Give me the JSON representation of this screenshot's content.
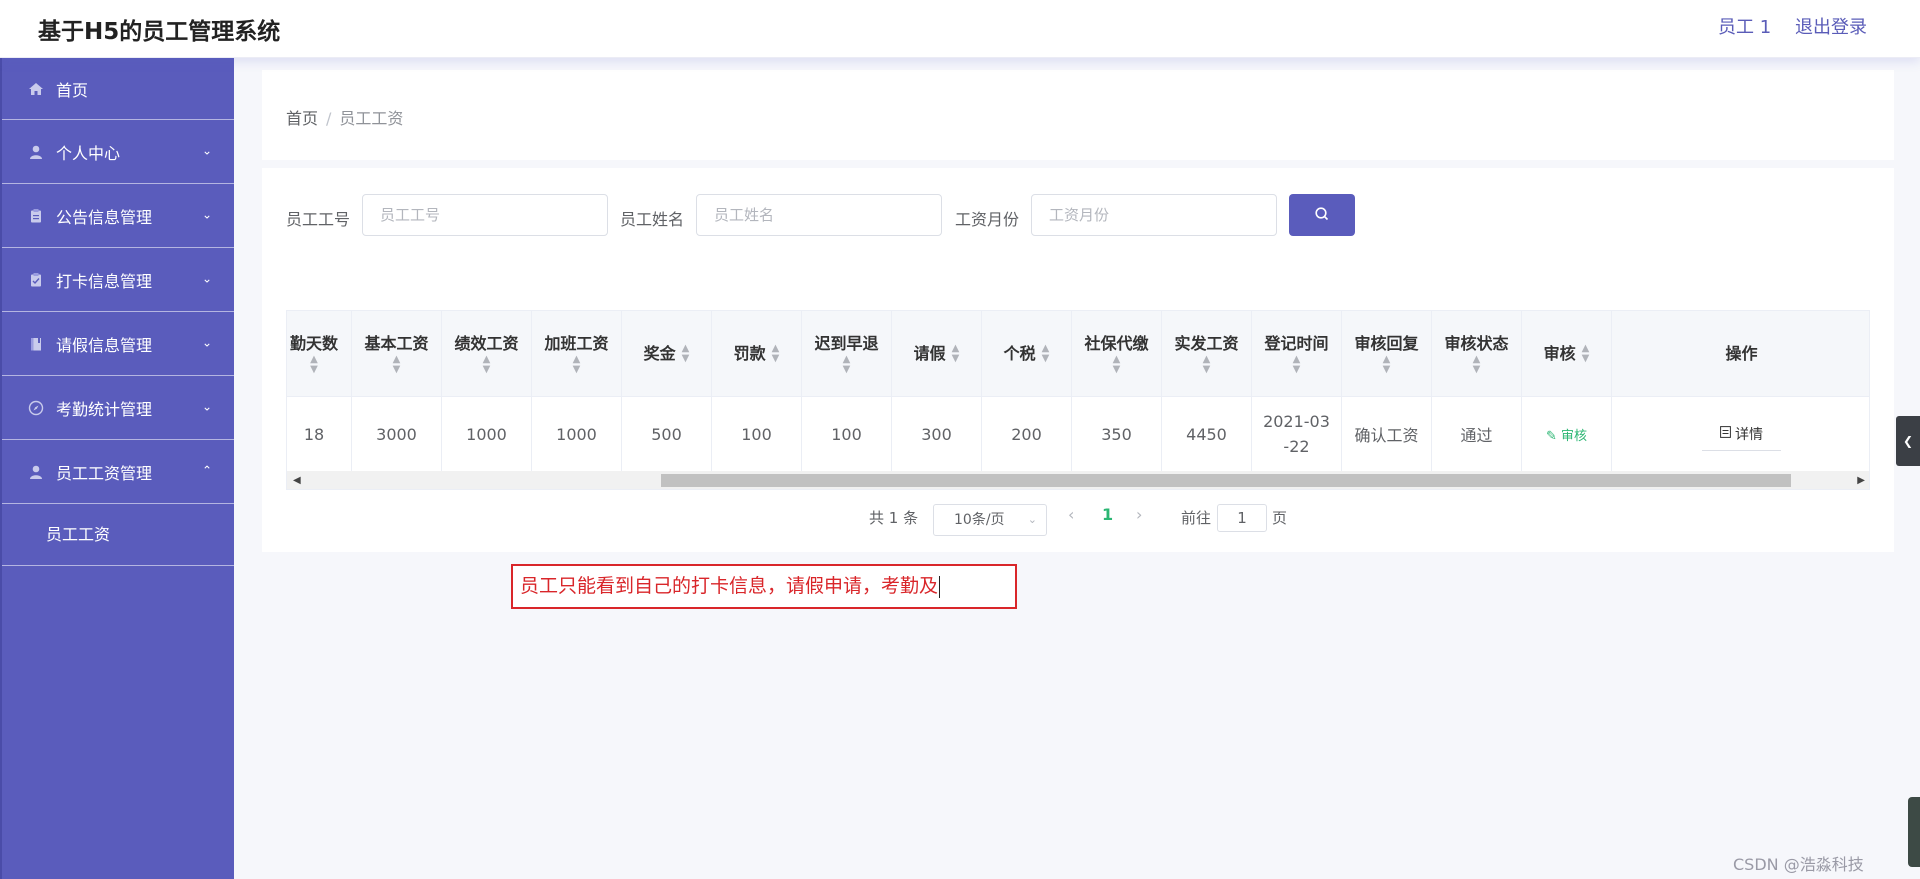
{
  "header": {
    "title": "基于H5的员工管理系统",
    "user": "员工 1",
    "logout": "退出登录"
  },
  "sidebar": {
    "items": [
      {
        "label": "首页",
        "icon": "home-icon",
        "expandable": false
      },
      {
        "label": "个人中心",
        "icon": "user-icon",
        "expandable": true
      },
      {
        "label": "公告信息管理",
        "icon": "clipboard-icon",
        "expandable": true
      },
      {
        "label": "打卡信息管理",
        "icon": "clipboard-check-icon",
        "expandable": true
      },
      {
        "label": "请假信息管理",
        "icon": "notebook-icon",
        "expandable": true
      },
      {
        "label": "考勤统计管理",
        "icon": "compass-icon",
        "expandable": true
      },
      {
        "label": "员工工资管理",
        "icon": "user-icon",
        "expandable": true,
        "expanded": true
      }
    ],
    "submenu": [
      "员工工资"
    ]
  },
  "breadcrumb": {
    "home": "首页",
    "separator": "/",
    "current": "员工工资"
  },
  "search": {
    "fields": [
      {
        "label": "员工工号",
        "placeholder": "员工工号"
      },
      {
        "label": "员工姓名",
        "placeholder": "员工姓名"
      },
      {
        "label": "工资月份",
        "placeholder": "工资月份"
      }
    ],
    "button_icon": "search-icon"
  },
  "table": {
    "headers": [
      "勤天数",
      "基本工资",
      "绩效工资",
      "加班工资",
      "奖金",
      "罚款",
      "迟到早退",
      "请假",
      "个税",
      "社保代缴",
      "实发工资",
      "登记时间",
      "审核回复",
      "审核状态",
      "审核",
      "操作"
    ],
    "rows": [
      {
        "attendance_days": "18",
        "base_salary": "3000",
        "performance_pay": "1000",
        "overtime_pay": "1000",
        "bonus": "500",
        "fine": "100",
        "late_early": "100",
        "leave": "300",
        "tax": "200",
        "social_security": "350",
        "net_pay": "4450",
        "register_time_line1": "2021-03",
        "register_time_line2": "-22",
        "review_reply": "确认工资",
        "review_status": "通过",
        "review_action": "审核",
        "detail_action": "详情"
      }
    ]
  },
  "pagination": {
    "total": "共 1 条",
    "page_size": "10条/页",
    "current_page": "1",
    "goto_label": "前往",
    "goto_value": "1",
    "page_suffix": "页"
  },
  "annotation": {
    "text": "员工只能看到自己的打卡信息，请假申请，考勤及"
  },
  "watermark": "CSDN @浩淼科技",
  "colors": {
    "sidebar_bg": "#5a5cbc",
    "accent": "#5a5cbc",
    "success": "#2bb673",
    "annotation": "#d9262a"
  }
}
